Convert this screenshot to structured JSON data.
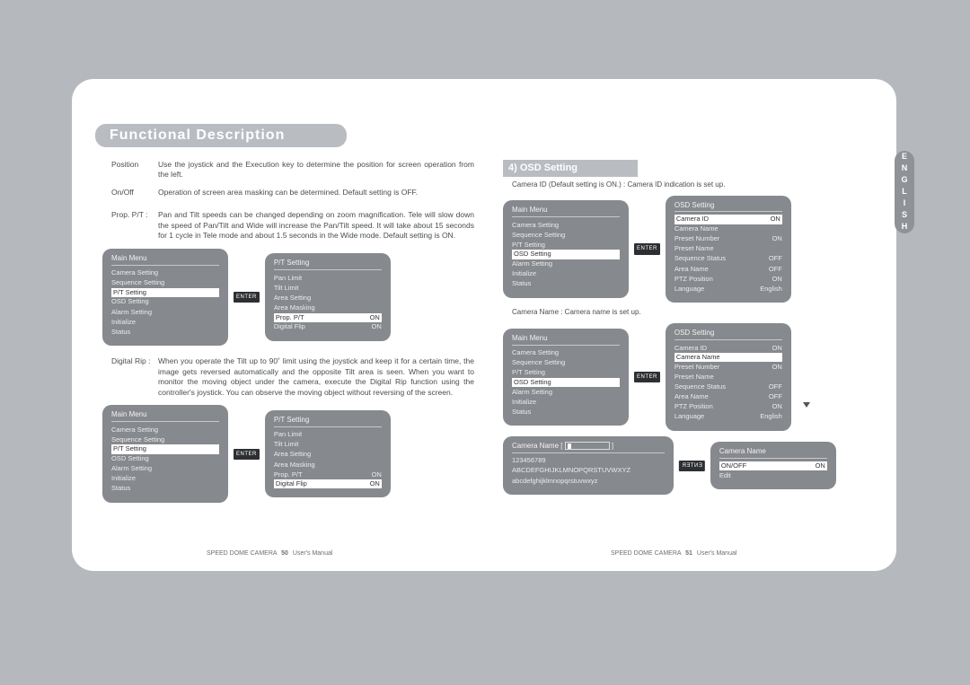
{
  "lang_tab": "ENGLISH",
  "title": "Functional Description",
  "left": {
    "p1_lbl": "Position",
    "p1_txt": "Use the joystick and the Execution key to determine the position for screen operation from the left.",
    "p2_lbl": "On/Off",
    "p2_txt": "Operation of screen area masking can be determined. Default setting is OFF.",
    "p3_lbl": "Prop. P/T :",
    "p3_txt": "Pan and Tilt speeds can be changed depending on zoom magnification. Tele will slow down the speed of Pan/Tilt and Wide will increase the Pan/Tilt speed. It will take about 15 seconds for 1 cycle in Tele mode and about 1.5 seconds in the Wide mode. Default setting is ON.",
    "p4_lbl": "Digital Rip :",
    "p4_txt": "When you operate the Tilt up to 90˚ limit using the joystick and keep it for a certain time, the image gets reversed automatically and the opposite Tilt area is seen. When you want to monitor the moving object under the camera, execute the Digital Rip function using the controller's joystick. You can observe the moving object without reversing of the screen.",
    "main_menu": {
      "title": "Main Menu",
      "items": [
        "Camera Setting",
        "Sequence Setting",
        "P/T Setting",
        "OSD Setting",
        "Alarm Setting",
        "Initialize",
        "Status"
      ],
      "selected": "P/T Setting"
    },
    "pt_setting_a": {
      "title": "P/T Setting",
      "rows": [
        {
          "l": "Pan Limit",
          "r": ""
        },
        {
          "l": "Tilt Limit",
          "r": ""
        },
        {
          "l": "Area Setting",
          "r": ""
        },
        {
          "l": "Area Masking",
          "r": ""
        },
        {
          "l": "Prop. P/T",
          "r": "ON",
          "sel": true
        },
        {
          "l": "Digital Flip",
          "r": "ON"
        }
      ]
    },
    "pt_setting_b": {
      "title": "P/T Setting",
      "rows": [
        {
          "l": "Pan Limit",
          "r": ""
        },
        {
          "l": "Tilt Limit",
          "r": ""
        },
        {
          "l": "Area Setting",
          "r": ""
        },
        {
          "l": "Area Masking",
          "r": ""
        },
        {
          "l": "Prop. P/T",
          "r": "ON"
        },
        {
          "l": "Digital Flip",
          "r": "ON",
          "sel": true
        }
      ]
    },
    "enter": "ENTER"
  },
  "right": {
    "section": "4) OSD Setting",
    "note1": "Camera ID (Default setting is ON.) : Camera ID indication is set up.",
    "note2": "Camera Name : Camera name is set up.",
    "main_menu": {
      "title": "Main Menu",
      "items": [
        "Camera Setting",
        "Sequence Setting",
        "P/T Setting",
        "OSD Setting",
        "Alarm Setting",
        "Initialize",
        "Status"
      ],
      "selected": "OSD Setting"
    },
    "osd_a": {
      "title": "OSD Setting",
      "rows": [
        {
          "l": "Camera ID",
          "r": "ON",
          "sel": true
        },
        {
          "l": "Camera Name",
          "r": ""
        },
        {
          "l": "Preset Number",
          "r": "ON"
        },
        {
          "l": "Preset Name",
          "r": ""
        },
        {
          "l": "Sequence Status",
          "r": "OFF"
        },
        {
          "l": "Area Name",
          "r": "OFF"
        },
        {
          "l": "PTZ Position",
          "r": "ON"
        },
        {
          "l": "Language",
          "r": "English"
        }
      ]
    },
    "osd_b": {
      "title": "OSD Setting",
      "rows": [
        {
          "l": "Camera ID",
          "r": "ON"
        },
        {
          "l": "Camera Name",
          "r": "",
          "sel": true
        },
        {
          "l": "Preset Number",
          "r": "ON"
        },
        {
          "l": "Preset Name",
          "r": ""
        },
        {
          "l": "Sequence Status",
          "r": "OFF"
        },
        {
          "l": "Area Name",
          "r": "OFF"
        },
        {
          "l": "PTZ Position",
          "r": "ON"
        },
        {
          "l": "Language",
          "r": "English"
        }
      ]
    },
    "cam_name_menu": {
      "title": "Camera Name",
      "rows": [
        {
          "l": "ON/OFF",
          "r": "ON",
          "sel": true
        },
        {
          "l": "Edit",
          "r": ""
        }
      ]
    },
    "cam_name_edit": {
      "title_prefix": "Camera Name",
      "line1": "123456789",
      "line2": "ABCDEFGHIJKLMNOPQRSTUVWXYZ",
      "line3": "abcdefghijklmnopqrstuvwxyz"
    },
    "enter": "ENTER"
  },
  "footer": {
    "brand": "SPEED DOME CAMERA",
    "pg_l": "50",
    "pg_r": "51",
    "suffix": "User's Manual"
  }
}
